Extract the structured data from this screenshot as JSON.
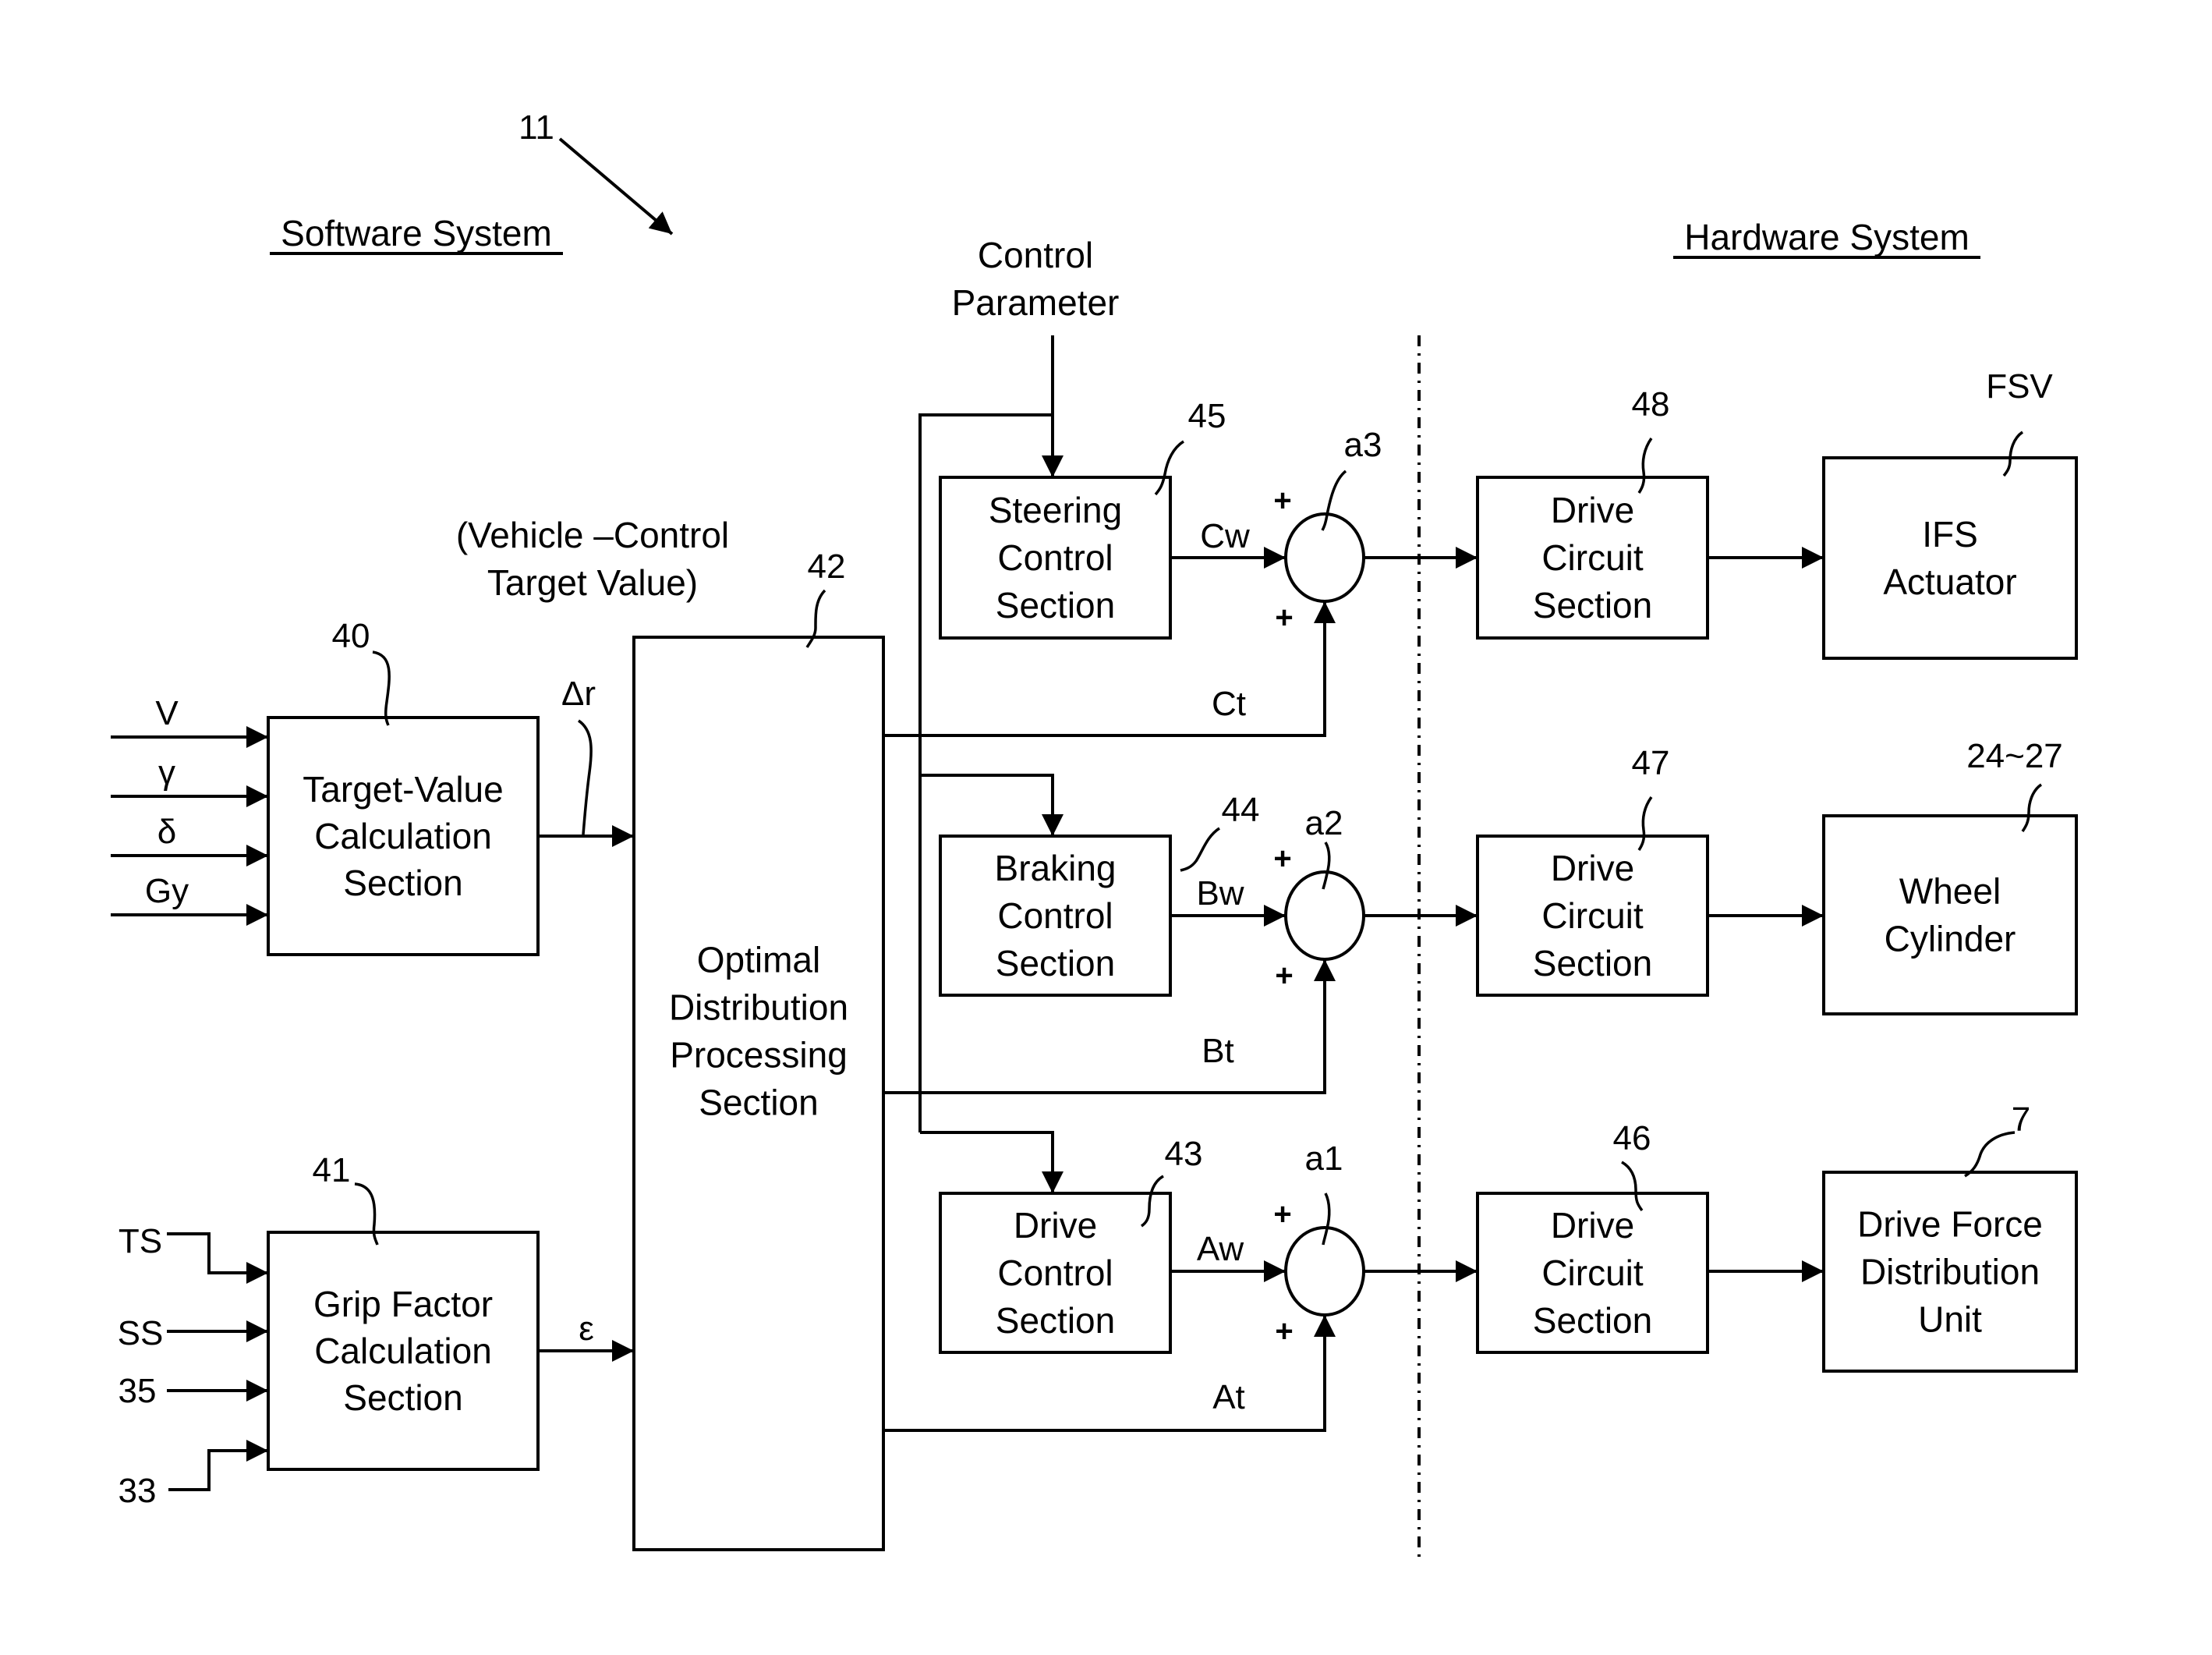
{
  "figure": {
    "reference": "11",
    "software_heading": "Software System",
    "hardware_heading": "Hardware System",
    "control_parameter": [
      "Control",
      "Parameter"
    ],
    "target_value_note": [
      "(Vehicle –Control",
      "Target Value)"
    ]
  },
  "blocks": {
    "target_value": {
      "ref": "40",
      "lines": [
        "Target-Value",
        "Calculation",
        "Section"
      ]
    },
    "grip_factor": {
      "ref": "41",
      "lines": [
        "Grip Factor",
        "Calculation",
        "Section"
      ]
    },
    "optimal_distribution": {
      "ref": "42",
      "lines": [
        "Optimal",
        "Distribution",
        "Processing",
        "Section"
      ]
    },
    "steering_control": {
      "ref": "45",
      "lines": [
        "Steering",
        "Control",
        "Section"
      ]
    },
    "braking_control": {
      "ref": "44",
      "lines": [
        "Braking",
        "Control",
        "Section"
      ]
    },
    "drive_control": {
      "ref": "43",
      "lines": [
        "Drive",
        "Control",
        "Section"
      ]
    },
    "drive_circuit_steer": {
      "ref": "48",
      "lines": [
        "Drive",
        "Circuit",
        "Section"
      ]
    },
    "drive_circuit_brake": {
      "ref": "47",
      "lines": [
        "Drive",
        "Circuit",
        "Section"
      ]
    },
    "drive_circuit_drive": {
      "ref": "46",
      "lines": [
        "Drive",
        "Circuit",
        "Section"
      ]
    },
    "ifs_actuator": {
      "ref": "FSV",
      "lines": [
        "IFS",
        "Actuator"
      ]
    },
    "wheel_cylinder": {
      "ref": "24~27",
      "lines": [
        "Wheel",
        "Cylinder"
      ]
    },
    "drive_force_unit": {
      "ref": "7",
      "lines": [
        "Drive Force",
        "Distribution",
        "Unit"
      ]
    }
  },
  "adders": {
    "a3": {
      "ref": "a3",
      "plus_top": "+",
      "plus_bottom": "+"
    },
    "a2": {
      "ref": "a2",
      "plus_top": "+",
      "plus_bottom": "+"
    },
    "a1": {
      "ref": "a1",
      "plus_top": "+",
      "plus_bottom": "+"
    }
  },
  "signals": {
    "inputs_target": [
      "V",
      "γ",
      "δ",
      "Gy"
    ],
    "inputs_grip": [
      "TS",
      "SS",
      "35",
      "33"
    ],
    "delta_r": "Δr",
    "epsilon": "ε",
    "Cw": "Cw",
    "Ct": "Ct",
    "Bw": "Bw",
    "Bt": "Bt",
    "Aw": "Aw",
    "At": "At"
  }
}
